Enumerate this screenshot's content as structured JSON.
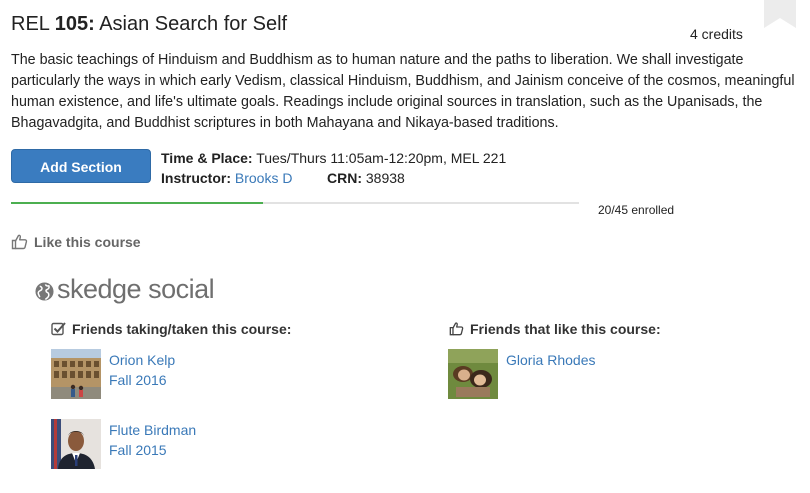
{
  "course": {
    "dept": "REL",
    "number": "105:",
    "name": "Asian Search for Self",
    "credits": "4 credits",
    "description": "The basic teachings of Hinduism and Buddhism as to human nature and the paths to liberation. We shall investigate particularly the ways in which early Vedism, classical Hinduism, Buddhism, and Jainism conceive of the cosmos, meaningful human existence, and life's ultimate goals. Readings include original sources in translation, such as the Upanisads, the Bhagavadgita, and Buddhist scriptures in both Mahayana and Nikaya-based traditions."
  },
  "section": {
    "add_label": "Add Section",
    "time_place_label": "Time & Place:",
    "time_place_value": "Tues/Thurs 11:05am-12:20pm, MEL 221",
    "instructor_label": "Instructor:",
    "instructor_value": "Brooks D",
    "crn_label": "CRN:",
    "crn_value": "38938",
    "enrolled_text": "20/45 enrolled",
    "enrolled_fraction": 0.444
  },
  "like": {
    "label": "Like this course",
    "icon": "thumbs-up-icon"
  },
  "social": {
    "brand": "skedge social",
    "icon": "globe-icon",
    "taking_heading": "Friends taking/taken this course:",
    "like_heading": "Friends that like this course:",
    "taking": [
      {
        "name": "Orion Kelp",
        "term": "Fall 2016"
      },
      {
        "name": "Flute Birdman",
        "term": "Fall 2015"
      }
    ],
    "liking": [
      {
        "name": "Gloria Rhodes"
      }
    ]
  },
  "colors": {
    "accent": "#3a7cc0",
    "link": "#3a79b8",
    "progress": "#4caf50"
  }
}
